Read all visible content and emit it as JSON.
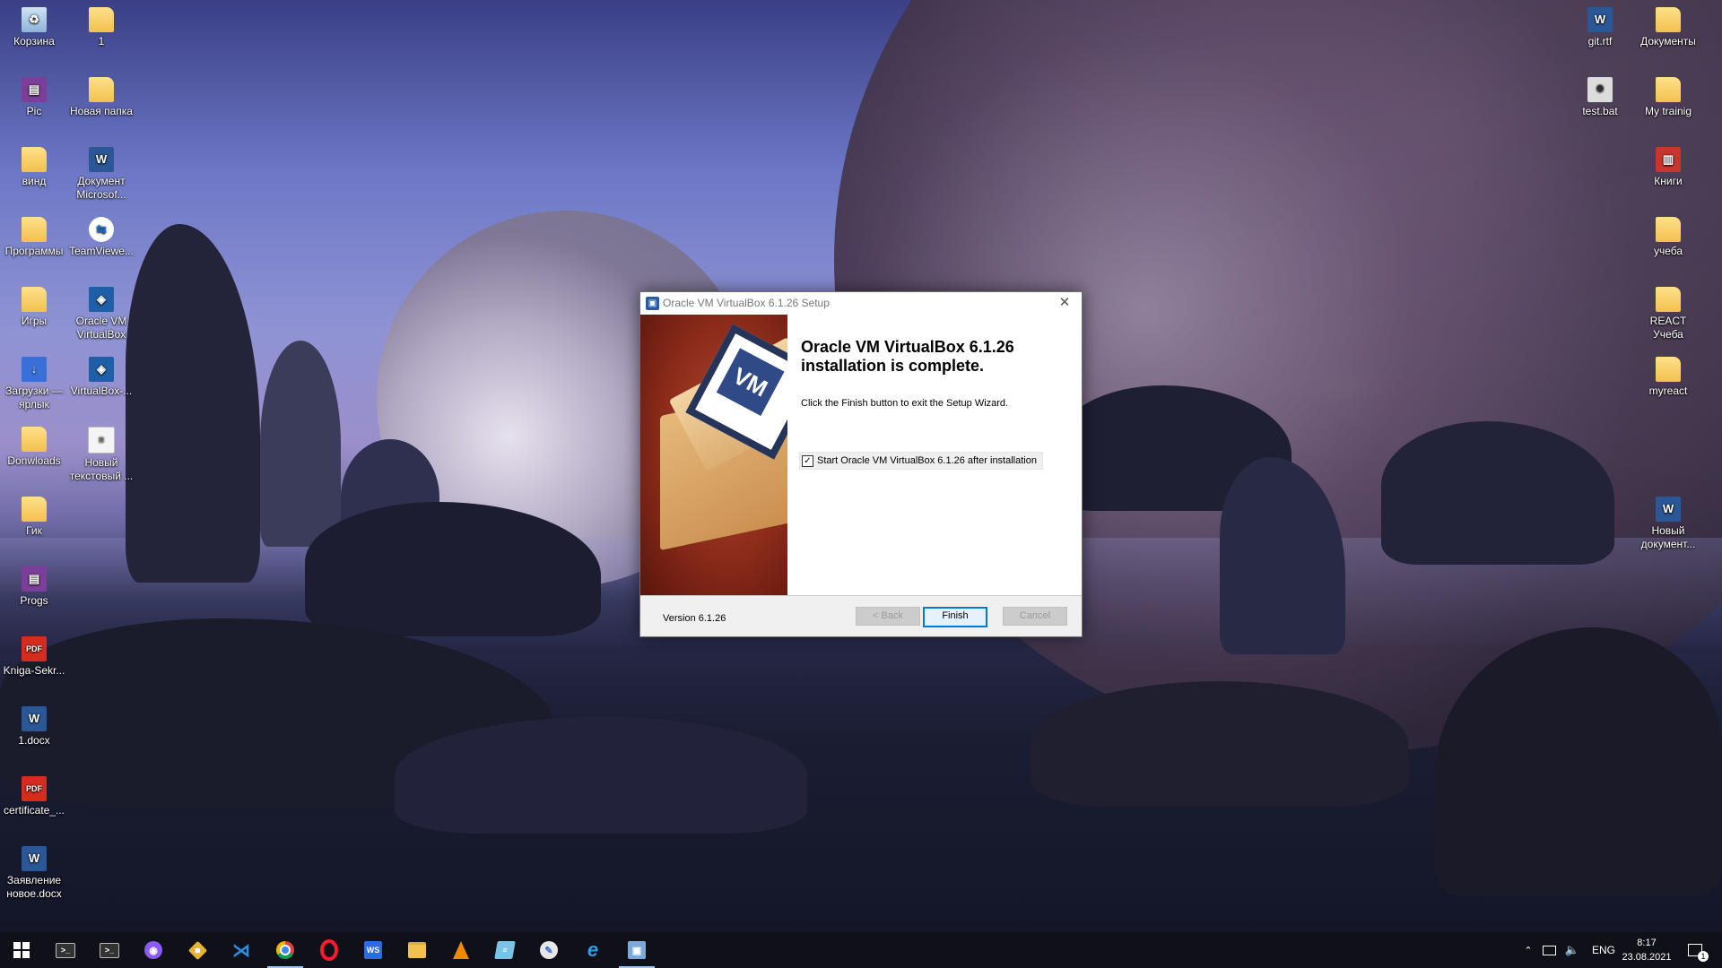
{
  "desktop": {
    "left_icons": [
      {
        "label": "Корзина",
        "icon": "recycle-bin-icon"
      },
      {
        "label": "1",
        "icon": "folder-icon"
      },
      {
        "label": "Pic",
        "icon": "winrar-archive-icon"
      },
      {
        "label": "Новая папка",
        "icon": "folder-icon"
      },
      {
        "label": "винд",
        "icon": "folder-icon"
      },
      {
        "label": "Документ Microsof...",
        "icon": "word-document-icon"
      },
      {
        "label": "Программы",
        "icon": "folder-icon"
      },
      {
        "label": "TeamViewe...",
        "icon": "teamviewer-icon"
      },
      {
        "label": "Игры",
        "icon": "folder-icon"
      },
      {
        "label": "Oracle VM VirtualBox",
        "icon": "virtualbox-icon"
      },
      {
        "label": "Загрузки — ярлык",
        "icon": "downloads-shortcut-icon"
      },
      {
        "label": "VirtualBox-...",
        "icon": "virtualbox-installer-icon"
      },
      {
        "label": "Donwloads",
        "icon": "folder-icon"
      },
      {
        "label": "Новый текстовый ...",
        "icon": "text-file-icon"
      },
      {
        "label": "Гик",
        "icon": "folder-icon"
      },
      {
        "label": "Progs",
        "icon": "archive-icon"
      },
      {
        "label": "Kniga-Sekr...",
        "icon": "pdf-icon"
      },
      {
        "label": "1.docx",
        "icon": "word-document-icon"
      },
      {
        "label": "certificate_...",
        "icon": "pdf-icon"
      },
      {
        "label": "Заявление новое.docx",
        "icon": "word-document-icon"
      }
    ],
    "right_icons": [
      {
        "label": "git.rtf",
        "icon": "word-document-icon"
      },
      {
        "label": "Документы",
        "icon": "folder-icon"
      },
      {
        "label": "test.bat",
        "icon": "batch-file-icon"
      },
      {
        "label": "My trainig",
        "icon": "folder-icon"
      },
      {
        "label": "Книги",
        "icon": "book-icon"
      },
      {
        "label": "учеба",
        "icon": "folder-icon"
      },
      {
        "label": "REACT Учеба",
        "icon": "folder-icon"
      },
      {
        "label": "myreact",
        "icon": "folder-icon"
      },
      {
        "label": "Новый документ...",
        "icon": "word-document-icon"
      }
    ]
  },
  "dialog": {
    "title": "Oracle VM VirtualBox 6.1.26 Setup",
    "close_glyph": "✕",
    "heading_line1": "Oracle VM VirtualBox 6.1.26",
    "heading_line2": "installation is complete.",
    "description": "Click the Finish button to exit the Setup Wizard.",
    "checkbox_label": "Start Oracle VM VirtualBox 6.1.26 after installation",
    "checkbox_checked": true,
    "checkbox_glyph": "✓",
    "version": "Version 6.1.26",
    "back_label": "< Back",
    "finish_label": "Finish",
    "cancel_label": "Cancel",
    "banner_logo": "VM"
  },
  "taskbar": {
    "apps": [
      {
        "name": "start-button",
        "icon": "windows-logo-icon"
      },
      {
        "name": "terminal",
        "icon": "terminal-icon"
      },
      {
        "name": "terminal-2",
        "icon": "terminal-icon"
      },
      {
        "name": "github-desktop",
        "icon": "github-icon"
      },
      {
        "name": "git-kraken",
        "icon": "git-icon"
      },
      {
        "name": "vscode",
        "icon": "vscode-icon"
      },
      {
        "name": "chrome",
        "icon": "chrome-icon"
      },
      {
        "name": "opera",
        "icon": "opera-icon"
      },
      {
        "name": "webstorm",
        "icon": "webstorm-icon"
      },
      {
        "name": "file-explorer",
        "icon": "folder-icon"
      },
      {
        "name": "vlc",
        "icon": "vlc-icon"
      },
      {
        "name": "notes",
        "icon": "notepad-icon"
      },
      {
        "name": "paint",
        "icon": "paint-icon"
      },
      {
        "name": "edge",
        "icon": "edge-icon"
      },
      {
        "name": "installer",
        "icon": "installer-icon"
      }
    ],
    "tray": {
      "language": "ENG",
      "time": "8:17",
      "date": "23.08.2021",
      "notification_count": "1"
    }
  }
}
